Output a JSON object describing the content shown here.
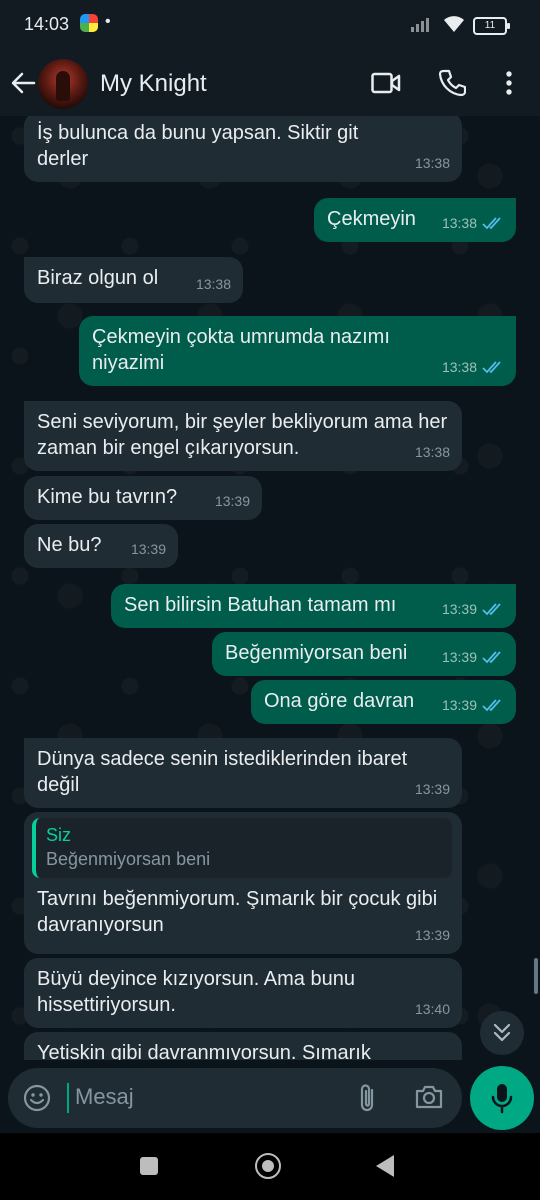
{
  "status_bar": {
    "time": "14:03",
    "dot": "•",
    "battery": "11"
  },
  "header": {
    "contact_name": "My Knight",
    "icons": [
      "back-arrow-icon",
      "video-call-icon",
      "voice-call-icon",
      "more-options-icon"
    ]
  },
  "messages": [
    {
      "dir": "in",
      "text": "İş bulunca da bunu yapsan. Siktir git derler",
      "time": "13:38"
    },
    {
      "dir": "out",
      "text": "Çekmeyin",
      "time": "13:38",
      "read": true
    },
    {
      "dir": "in",
      "text": "Biraz olgun ol",
      "time": "13:38"
    },
    {
      "dir": "out",
      "text": "Çekmeyin çokta umrumda nazımı niyazimi",
      "time": "13:38",
      "read": true
    },
    {
      "dir": "in",
      "text": "Seni seviyorum, bir şeyler bekliyorum ama her zaman bir engel çıkarıyorsun.",
      "time": "13:38"
    },
    {
      "dir": "in",
      "text": "Kime bu tavrın?",
      "time": "13:39"
    },
    {
      "dir": "in",
      "text": "Ne bu?",
      "time": "13:39"
    },
    {
      "dir": "out",
      "text": "Sen bilirsin Batuhan tamam mı",
      "time": "13:39",
      "read": true
    },
    {
      "dir": "out",
      "text": "Beğenmiyorsan beni",
      "time": "13:39",
      "read": true
    },
    {
      "dir": "out",
      "text": "Ona göre davran",
      "time": "13:39",
      "read": true
    },
    {
      "dir": "in",
      "text": "Dünya sadece senin istediklerinden ibaret değil",
      "time": "13:39"
    },
    {
      "dir": "in",
      "quote_name": "Siz",
      "quote_text": "Beğenmiyorsan beni",
      "text": "Tavrını beğenmiyorum. Şımarık bir çocuk gibi davranıyorsun",
      "time": "13:39"
    },
    {
      "dir": "in",
      "text": "Büyü deyince kızıyorsun. Ama bunu hissettiriyorsun.",
      "time": "13:40"
    },
    {
      "dir": "in",
      "text": "Yetiskin gibi davranmıyorsun. Sımarık",
      "time": ""
    }
  ],
  "input": {
    "placeholder": "Mesaj"
  },
  "colors": {
    "background": "#0b141a",
    "incoming_bubble": "#202c33",
    "outgoing_bubble": "#005c4b",
    "accent": "#00a884",
    "read_ticks": "#53bdeb"
  }
}
